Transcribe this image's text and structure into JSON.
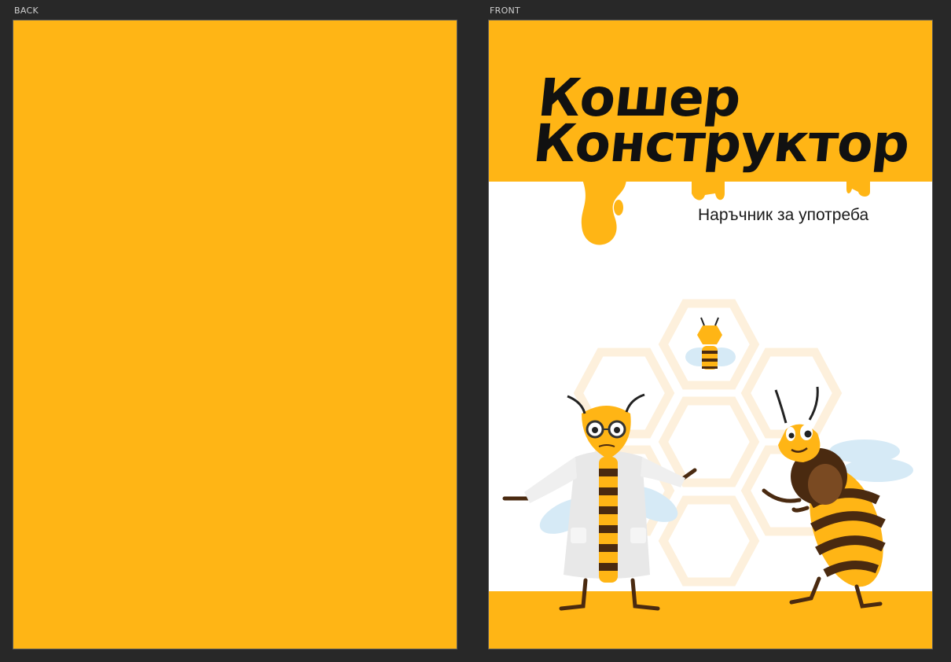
{
  "panels": {
    "back": {
      "label": "BACK"
    },
    "front": {
      "label": "FRONT"
    }
  },
  "cover": {
    "title_line1": "Кошер",
    "title_line2": "Конструктор",
    "subtitle": "Наръчник за употреба"
  },
  "colors": {
    "canvas": "#282828",
    "honey": "#ffb515",
    "ink": "#111111",
    "white": "#ffffff",
    "hex_outline": "#fdf0dc",
    "wing": "#d6eaf6",
    "bee_brown": "#4a2a10"
  },
  "icons": [
    "honey-drip",
    "honeycomb-pattern",
    "scientist-bee",
    "small-bee",
    "happy-bee"
  ]
}
